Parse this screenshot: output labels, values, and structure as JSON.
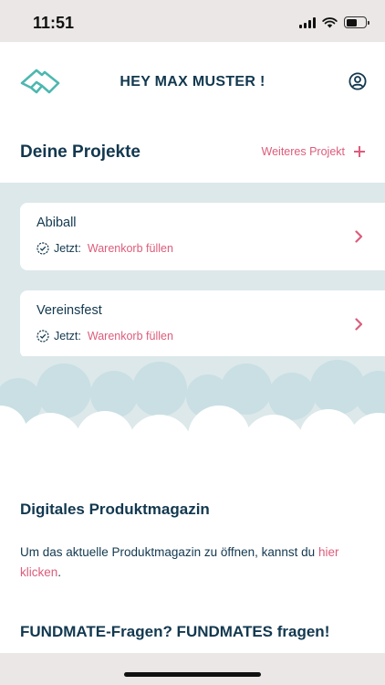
{
  "status_bar": {
    "time": "11:51"
  },
  "header": {
    "title": "HEY MAX MUSTER !",
    "logo_icon": "mountain-logo-icon",
    "account_icon": "user-circle-icon"
  },
  "projects_section": {
    "title": "Deine Projekte",
    "add_label": "Weiteres Projekt",
    "items": [
      {
        "name": "Abiball",
        "status_label": "Jetzt:",
        "status_value": "Warenkorb füllen"
      },
      {
        "name": "Vereinsfest",
        "status_label": "Jetzt:",
        "status_value": "Warenkorb füllen"
      }
    ]
  },
  "magazin": {
    "title": "Digitales Produktmagazin",
    "text_before": "Um das aktuelle Produktmagazin zu öffnen, kannst du ",
    "link": "hier klicken",
    "text_after": "."
  },
  "faq": {
    "title": "FUNDMATE-Fragen? FUNDMATES fragen!"
  },
  "colors": {
    "primary": "#12384f",
    "accent": "#dd5c7b",
    "logo": "#4cb8b0",
    "band": "#dce8ea",
    "cloud": "#c9dfe3"
  }
}
